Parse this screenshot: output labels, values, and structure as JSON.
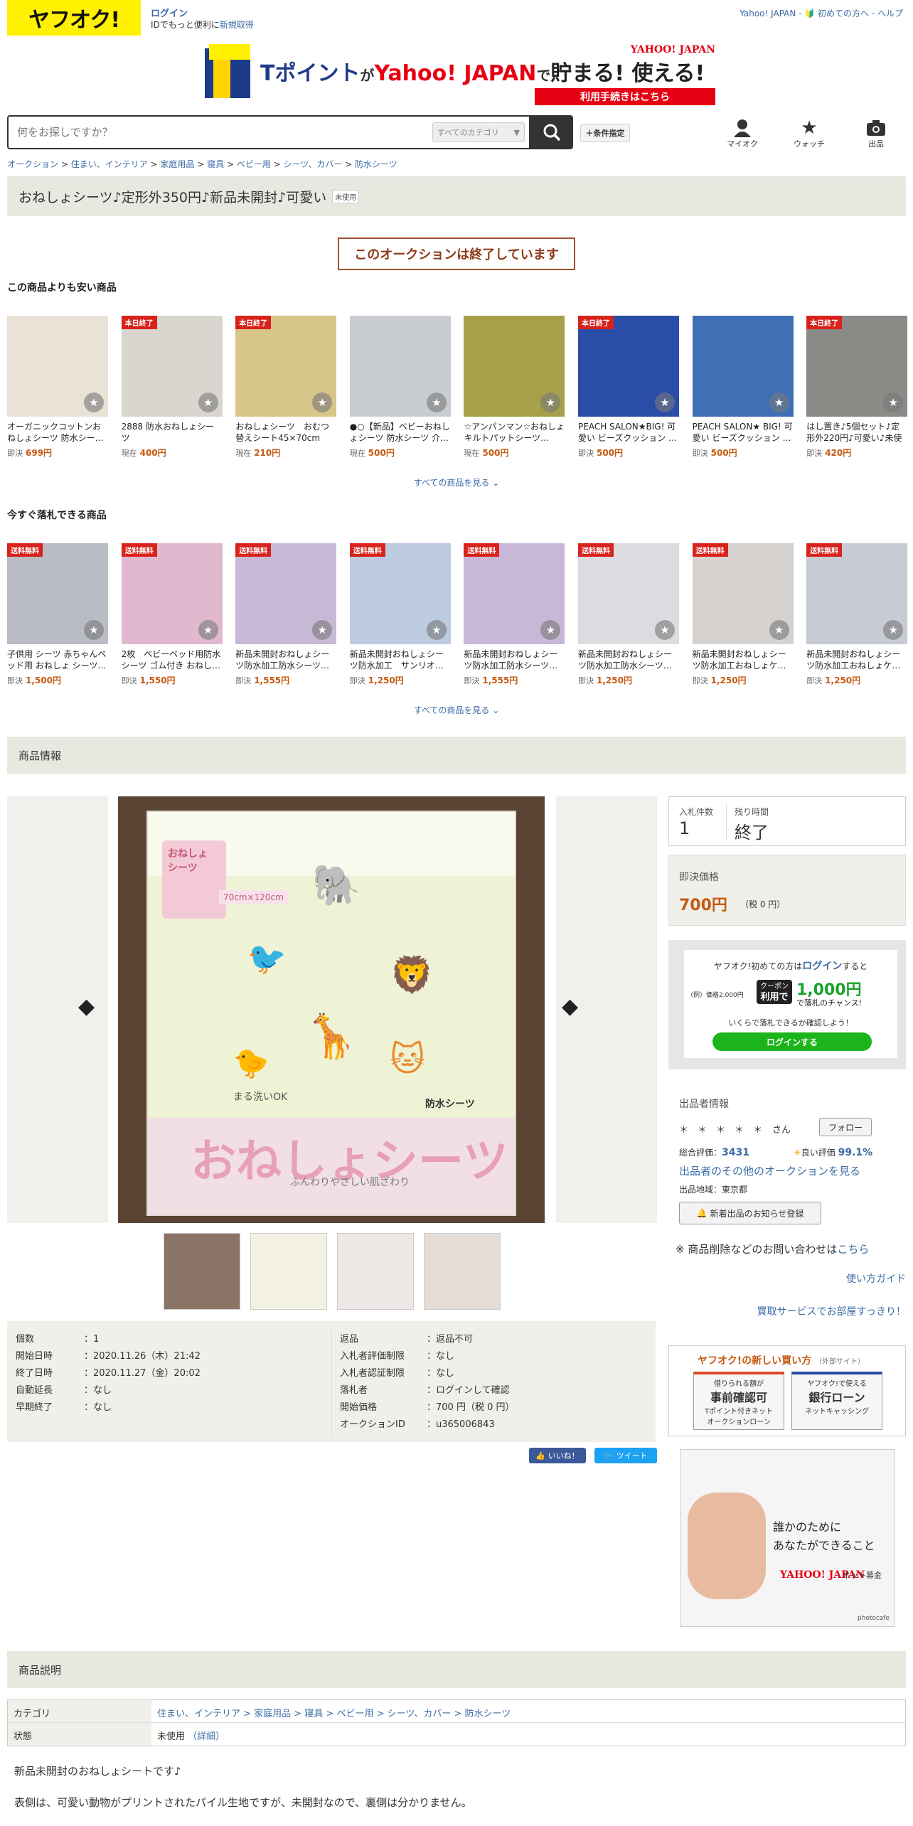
{
  "header": {
    "logo": "ヤフオク!",
    "login": "ログイン",
    "login_sub_prefix": "IDでもっと便利に",
    "register": "新規取得",
    "top_links": "Yahoo! JAPAN - 🔰 初めての方へ - ヘルプ",
    "banner": {
      "brand": "YAHOO! JAPAN",
      "line1_a": "Tポイント",
      "line1_b": "が",
      "line1_c": "Yahoo! JAPAN",
      "line1_d": "で",
      "line1_e": "貯まる! 使える!",
      "cta": "利用手続きはこちら"
    }
  },
  "search": {
    "placeholder": "何をお探しですか？",
    "category": "すべてのカテゴリ",
    "conditions": "＋条件指定",
    "icons": [
      {
        "label": "マイオク",
        "icon": "person-icon"
      },
      {
        "label": "ウォッチ",
        "icon": "star-icon"
      },
      {
        "label": "出品",
        "icon": "camera-icon"
      }
    ]
  },
  "breadcrumb": [
    "オークション",
    "住まい、インテリア",
    "家庭用品",
    "寝具",
    "ベビー用",
    "シーツ、カバー",
    "防水シーツ"
  ],
  "item": {
    "title": "おねしょシーツ♪定形外350円♪新品未開封♪可愛い",
    "condition_tag": "未使用",
    "ended": "このオークションは終了しています"
  },
  "cheaper": {
    "heading": "この商品よりも安い商品",
    "more": "すべての商品を見る",
    "items": [
      {
        "name": "オーガニックコットンおねしょシーツ 防水シー…",
        "ptype": "即決",
        "price": "699円",
        "badge": "",
        "color": "#e9e2d6"
      },
      {
        "name": "2888 防水おねしょシーツ",
        "ptype": "現在",
        "price": "400円",
        "badge": "本日終了",
        "color": "#d9d6cf"
      },
      {
        "name": "おねしょシーツ　おむつ替えシート45×70cm",
        "ptype": "現在",
        "price": "210円",
        "badge": "本日終了",
        "color": "#d8c58a"
      },
      {
        "name": "●○【新品】ベビーおねしょシーツ 防水シーツ 介…",
        "ptype": "現在",
        "price": "500円",
        "badge": "",
        "color": "#c9cdd2"
      },
      {
        "name": "☆アンパンマン☆おねしょキルトパットシーツ…",
        "ptype": "現在",
        "price": "500円",
        "badge": "",
        "color": "#a7a04a"
      },
      {
        "name": "PEACH SALON★BIG! 可愛い ビーズクッション …",
        "ptype": "即決",
        "price": "500円",
        "badge": "本日終了",
        "color": "#2a4ea8"
      },
      {
        "name": "PEACH SALON★ BIG! 可愛い ビーズクッション …",
        "ptype": "即決",
        "price": "500円",
        "badge": "",
        "color": "#3f6fb5"
      },
      {
        "name": "はし置き♪5個セット♪定形外220円♪可愛い♪未使用",
        "ptype": "即決",
        "price": "420円",
        "badge": "本日終了",
        "color": "#8b8a86"
      }
    ]
  },
  "buynow": {
    "heading": "今すぐ落札できる商品",
    "more": "すべての商品を見る",
    "items": [
      {
        "name": "子供用 シーツ 赤ちゃんベッド用 おねしょ シーツ…",
        "ptype": "即決",
        "price": "1,500円",
        "badge": "送料無料",
        "color": "#b9bcc4"
      },
      {
        "name": "2枚　ベビーベッド用防水シーツ ゴム付き おねし…",
        "ptype": "即決",
        "price": "1,550円",
        "badge": "送料無料",
        "color": "#e0b9cf"
      },
      {
        "name": "新品未開封おねしょシーツ防水加工防水シーツ…",
        "ptype": "即決",
        "price": "1,555円",
        "badge": "送料無料",
        "color": "#c7b9d6"
      },
      {
        "name": "新品未開封おねしょシーツ防水加工　サンリオ…",
        "ptype": "即決",
        "price": "1,250円",
        "badge": "送料無料",
        "color": "#bccbe0"
      },
      {
        "name": "新品未開封おねしょシーツ防水加工防水シーツ…",
        "ptype": "即決",
        "price": "1,555円",
        "badge": "送料無料",
        "color": "#c9b7d8"
      },
      {
        "name": "新品未開封おねしょシーツ防水加工防水シーツ…",
        "ptype": "即決",
        "price": "1,250円",
        "badge": "送料無料",
        "color": "#dcdbe0"
      },
      {
        "name": "新品未開封おねしょシーツ防水加工おねしょケ…",
        "ptype": "即決",
        "price": "1,250円",
        "badge": "送料無料",
        "color": "#d5d2cf"
      },
      {
        "name": "新品未開封おねしょシーツ防水加工おねしょケ…",
        "ptype": "即決",
        "price": "1,250円",
        "badge": "送料無料",
        "color": "#c7cbd4"
      }
    ]
  },
  "product_info": {
    "heading": "商品情報",
    "bid_count_label": "入札件数",
    "bid_count": "1",
    "time_left_label": "残り時間",
    "time_left": "終了",
    "buyout_label": "即決価格",
    "buyout_price": "700円",
    "buyout_tax": "（税 0 円）",
    "promo": {
      "line1_a": "ヤフオク!初めての方は",
      "line1_b": "ログイン",
      "line1_c": "すると",
      "example": "（例）価格2,000円",
      "coupon_a": "クーポン",
      "coupon_b": "利用で",
      "amount": "1,000円",
      "chance": "で落札のチャンス!",
      "check": "いくらで落札できるか確認しよう！",
      "button": "ログインする"
    },
    "seller": {
      "heading": "出品者情報",
      "name": "＊　＊　＊　＊　＊",
      "san": "さん",
      "follow": "フォロー",
      "rating_label": "総合評価：",
      "rating": "3431",
      "good_label": "良い評価",
      "good": "99.1%",
      "other": "出品者のその他のオークションを見る",
      "region": "出品地域：東京都",
      "notify": "新着出品のお知らせ登録"
    },
    "inquiry_a": "※ 商品削除などのお問い合わせは",
    "inquiry_b": "こちら",
    "guide": "使い方ガイド",
    "buy_service": "買取サービスでお部屋すっきり！",
    "new_way": {
      "title": "ヤフオク!の新しい買い方",
      "ext": "（外部サイト）",
      "a_top": "借りられる額が",
      "a_main": "事前確認可",
      "a_sub1": "Tポイント付きネット",
      "a_sub2": "オークションローン",
      "b_top": "ヤフオク!で使える",
      "b_main": "銀行ローン",
      "b_sub": "ネットキャッシング"
    },
    "ad": {
      "line1": "誰かのために",
      "line2": "あなたができること",
      "brand": "YAHOO! JAPAN",
      "sub": "ネット募金",
      "credit": "photocafe"
    }
  },
  "details": {
    "left": [
      {
        "k": "個数",
        "v": "1",
        "link": false
      },
      {
        "k": "開始日時",
        "v": "2020.11.26（木）21:42",
        "link": false
      },
      {
        "k": "終了日時",
        "v": "2020.11.27（金）20:02",
        "link": false
      },
      {
        "k": "自動延長",
        "v": "なし",
        "link": true
      },
      {
        "k": "早期終了",
        "v": "なし",
        "link": true
      }
    ],
    "right": [
      {
        "k": "返品",
        "v": "返品不可",
        "link": false,
        "vlink": false
      },
      {
        "k": "入札者評価制限",
        "v": "なし",
        "link": true,
        "vlink": false
      },
      {
        "k": "入札者認証制限",
        "v": "なし",
        "link": true,
        "vlink": false
      },
      {
        "k": "落札者",
        "v": "ログインして確認",
        "link": false,
        "vlink": true
      },
      {
        "k": "開始価格",
        "v": "700 円（税 0 円）",
        "link": false,
        "vlink": false
      },
      {
        "k": "オークションID",
        "v": "u365006843",
        "link": false,
        "vlink": false
      }
    ],
    "like": "👍 いいね！",
    "tweet": "🐦 ツイート"
  },
  "description": {
    "heading": "商品説明",
    "category_label": "カテゴリ",
    "category_path": "住まい、インテリア > 家庭用品 > 寝具 > ベビー用 > シーツ、カバー > 防水シーツ",
    "condition_label": "状態",
    "condition_value": "未使用",
    "condition_detail": "（詳細）",
    "line1": "新品未開封のおねしょシートです♪",
    "line2": "表側は、可愛い動物がプリントされたパイル生地ですが、未開封なので、裏側は分かりません。"
  },
  "package": {
    "label_a": "おねしょ",
    "label_b": "シーツ",
    "size": "70cm×120cm",
    "wash": "まる洗いOK",
    "bosui": "防水シーツ",
    "big": "おねしょシーツ",
    "sub": "ふんわりやさしい肌ざわり"
  }
}
